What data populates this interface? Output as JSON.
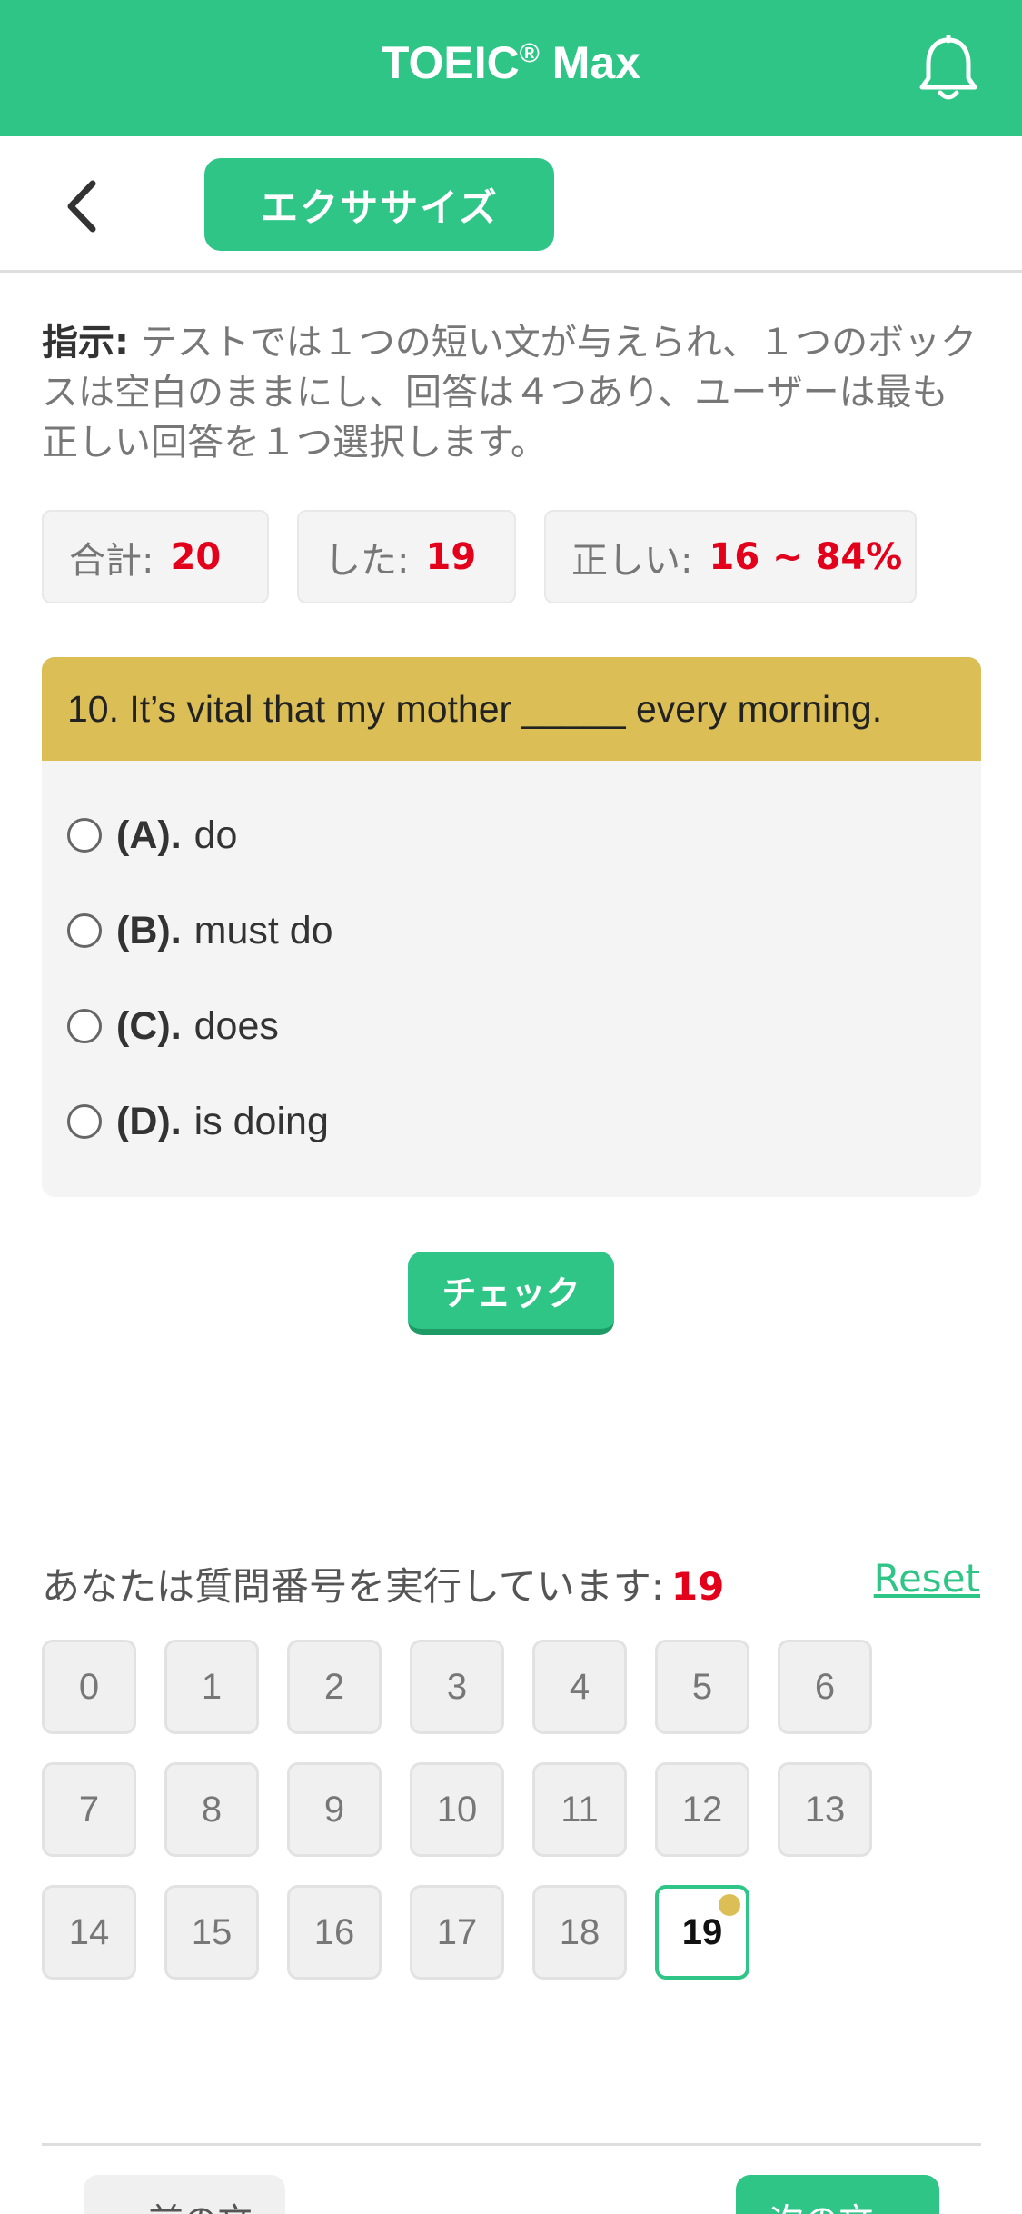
{
  "header": {
    "title": "TOEIC",
    "title_mark": "®",
    "title_suffix": " Max",
    "bell_icon": "bell-icon"
  },
  "subbar": {
    "back_icon": "chevron-left-icon",
    "tab_label": "エクササイズ"
  },
  "instructions": {
    "label": "指示:",
    "text": " テストでは１つの短い文が与えられ、１つのボックスは空白のままにし、回答は４つあり、ユーザーは最も正しい回答を１つ選択します。"
  },
  "stats": {
    "total_label": "合計:",
    "total_value": "20",
    "done_label": "した:",
    "done_value": "19",
    "correct_label": "正しい:",
    "correct_value": "16 ~ 84%"
  },
  "question": {
    "text": "10. It’s vital that my mother _____ every morning.",
    "options": [
      {
        "letter": "(A).",
        "text": "do"
      },
      {
        "letter": "(B).",
        "text": "must do"
      },
      {
        "letter": "(C).",
        "text": "does"
      },
      {
        "letter": "(D).",
        "text": "is doing"
      }
    ]
  },
  "check_label": "チェック",
  "progress": {
    "label": "あなたは質問番号を実行しています:",
    "current": "19",
    "reset_label": "Reset",
    "numbers": [
      "0",
      "1",
      "2",
      "3",
      "4",
      "5",
      "6",
      "7",
      "8",
      "9",
      "10",
      "11",
      "12",
      "13",
      "14",
      "15",
      "16",
      "17",
      "18",
      "19"
    ]
  },
  "nav": {
    "prev_label": "« 前の文",
    "next_label": "次の文 »"
  },
  "colors": {
    "brand": "#2ec587",
    "question_header": "#dbbe55",
    "highlight": "#e3001b"
  }
}
